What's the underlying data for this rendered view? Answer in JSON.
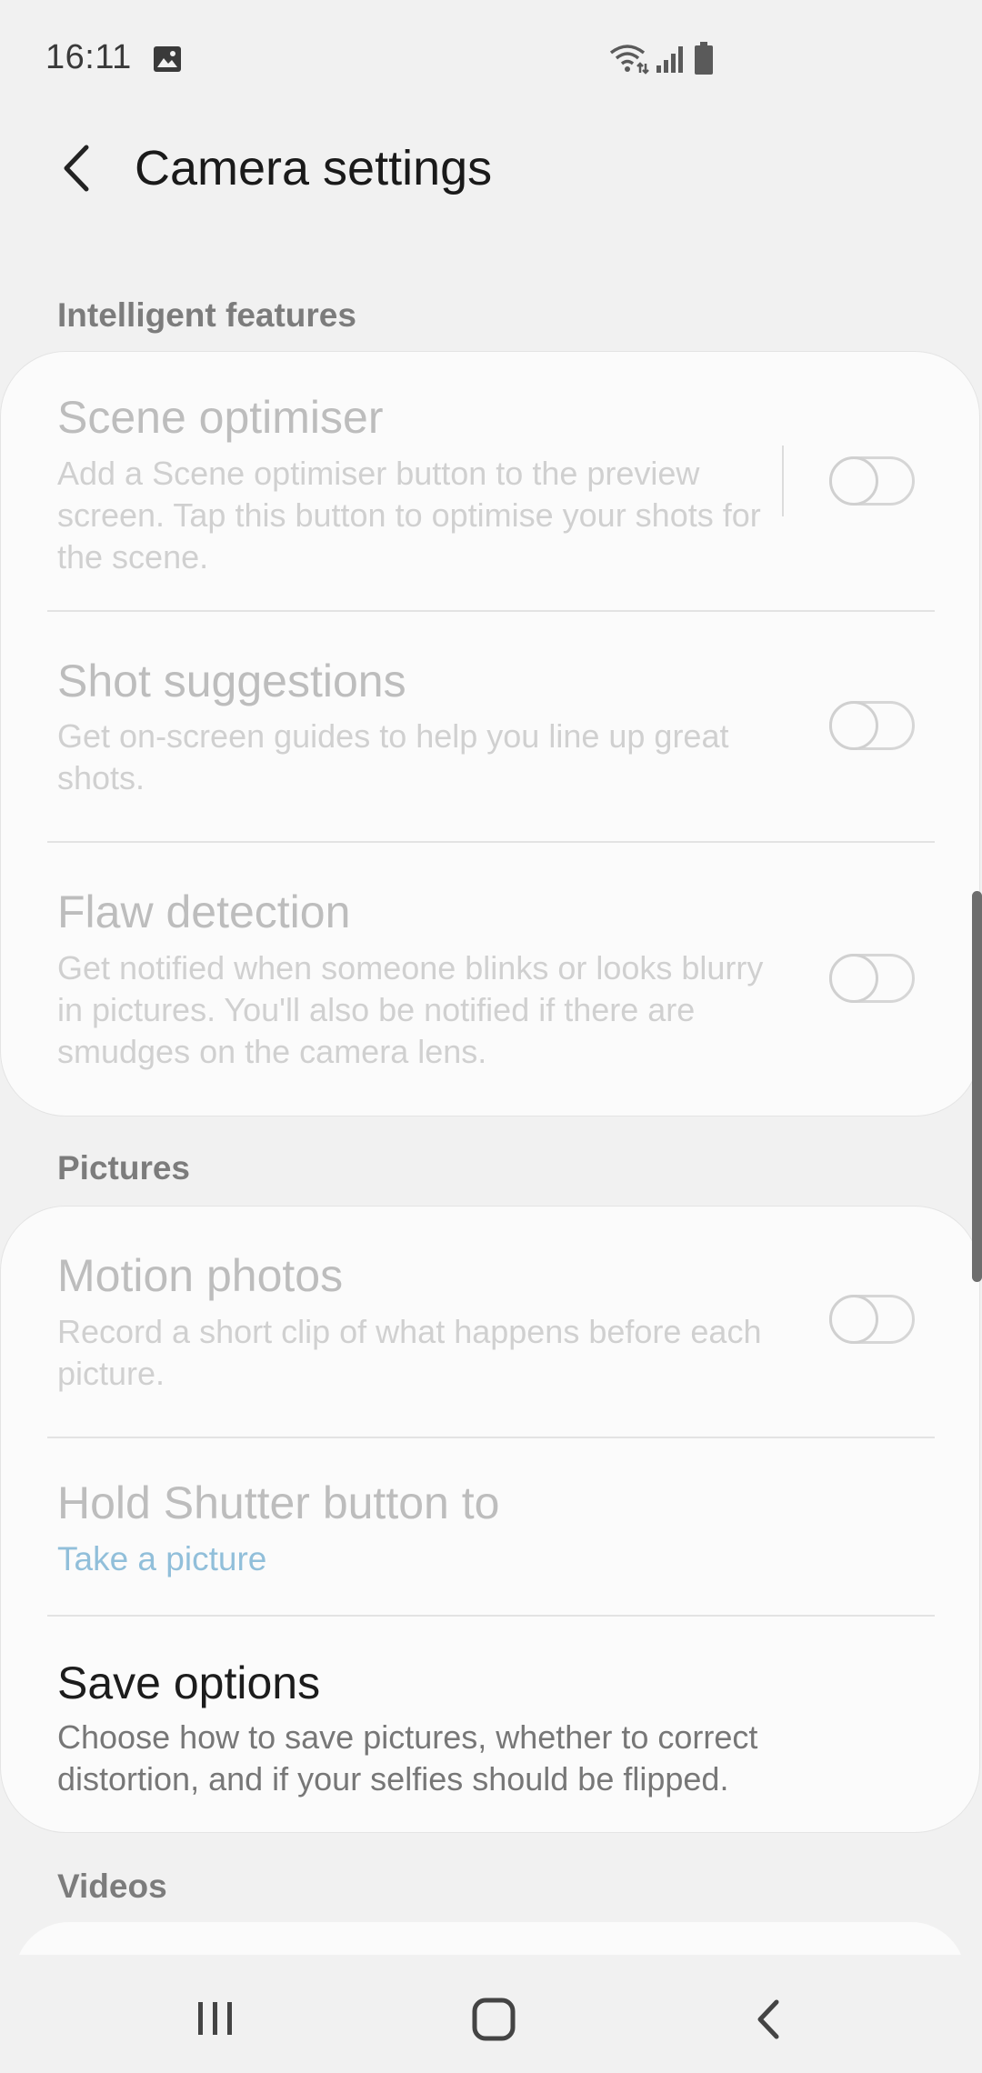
{
  "status_bar": {
    "time": "16:11",
    "icons": [
      "gallery-icon",
      "wifi-icon",
      "signal-icon",
      "battery-icon"
    ]
  },
  "header": {
    "back_icon": "chevron-left-icon",
    "title": "Camera settings"
  },
  "sections": {
    "intelligent": {
      "header": "Intelligent features",
      "items": [
        {
          "title": "Scene optimiser",
          "description": "Add a Scene optimiser button to the preview screen. Tap this button to optimise your shots for the scene.",
          "toggle": "off",
          "enabled": false
        },
        {
          "title": "Shot suggestions",
          "description": "Get on-screen guides to help you line up great shots.",
          "toggle": "off",
          "enabled": false
        },
        {
          "title": "Flaw detection",
          "description": "Get notified when someone blinks or looks blurry in pictures. You'll also be notified if there are smudges on the camera lens.",
          "toggle": "off",
          "enabled": false
        }
      ]
    },
    "pictures": {
      "header": "Pictures",
      "items": [
        {
          "title": "Motion photos",
          "description": "Record a short clip of what happens before each picture.",
          "toggle": "off",
          "enabled": false
        },
        {
          "title": "Hold Shutter button to",
          "value": "Take a picture",
          "enabled": false
        },
        {
          "title": "Save options",
          "description": "Choose how to save pictures, whether to correct distortion, and if your selfies should be flipped.",
          "enabled": true
        }
      ]
    },
    "videos": {
      "header": "Videos"
    }
  },
  "nav_bar": {
    "icons": [
      "recents-icon",
      "home-icon",
      "back-icon"
    ]
  },
  "colors": {
    "background": "#f1f1f1",
    "card": "#fbfbfb",
    "section_header": "#7c7c7c",
    "link": "#91bfda",
    "disabled_text": "#bdbdbd"
  }
}
